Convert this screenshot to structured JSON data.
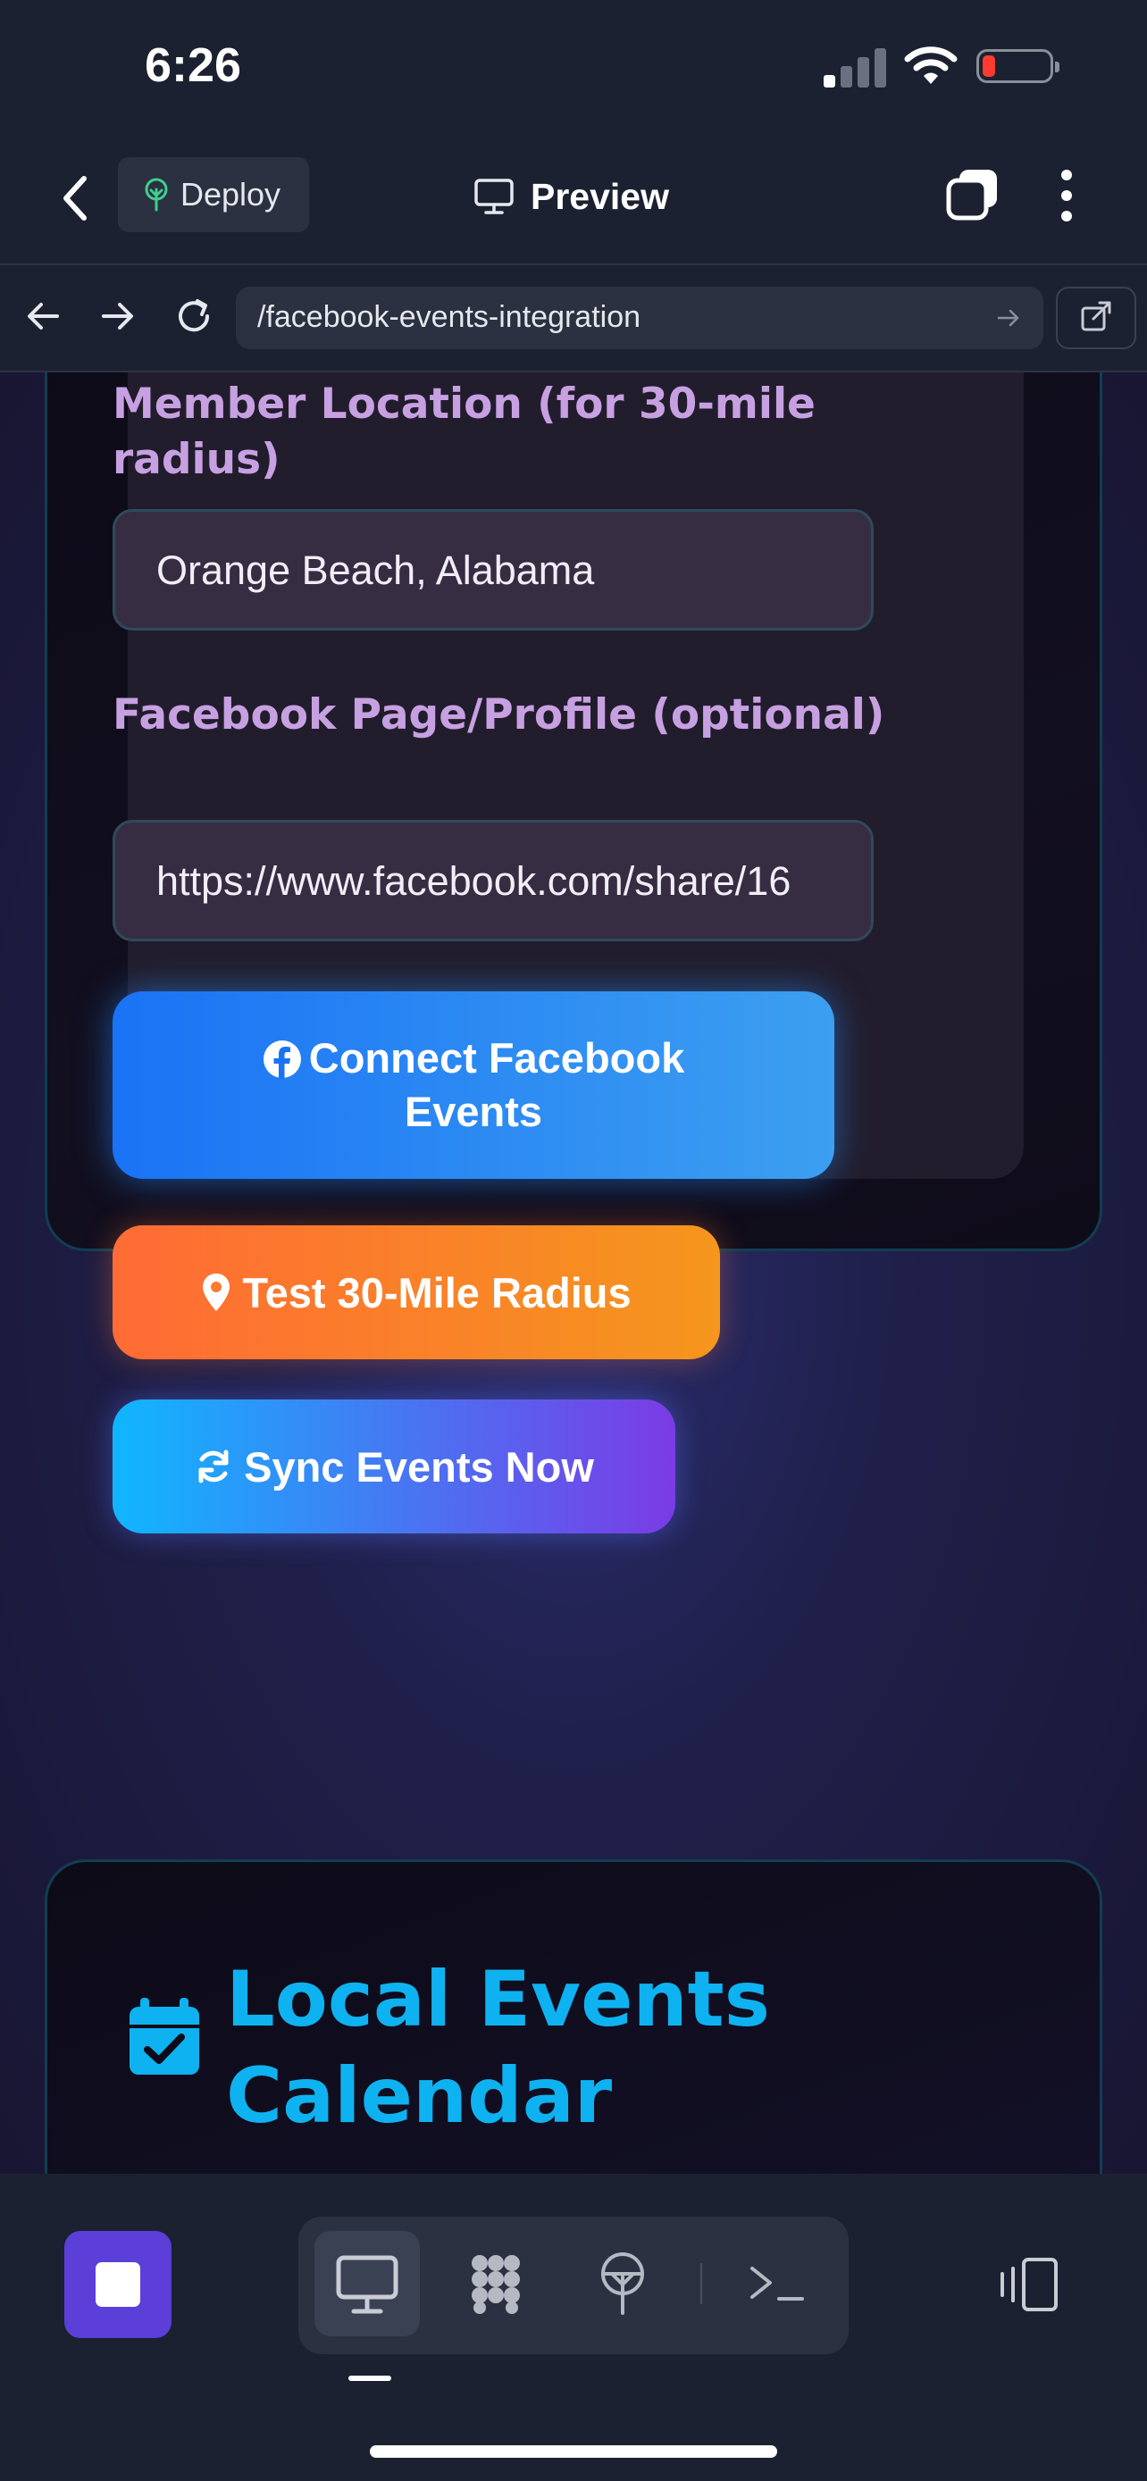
{
  "status_bar": {
    "time": "6:26"
  },
  "top_bar": {
    "deploy_label": "Deploy",
    "preview_label": "Preview"
  },
  "url_bar": {
    "url": "/facebook-events-integration"
  },
  "form": {
    "location_label": "Member Location (for 30-mile radius)",
    "location_value": "Orange Beach, Alabama",
    "facebook_label": "Facebook Page/Profile (optional)",
    "facebook_value": "https://www.facebook.com/share/16"
  },
  "buttons": {
    "connect_facebook": "Connect Facebook Events",
    "test_radius": "Test 30-Mile Radius",
    "sync_events": "Sync Events Now"
  },
  "calendar_section": {
    "title": "Local Events Calendar"
  },
  "colors": {
    "accent_blue": "#1a73f5",
    "accent_orange": "#ff6b35",
    "accent_purple": "#7b3be6",
    "label_lavender": "#c7a0e2",
    "calendar_title": "#0fb2f0",
    "stop_button": "#5b3fd8"
  },
  "icons": {
    "deploy": "deploy-tree-icon",
    "preview": "monitor-icon",
    "connect": "facebook-icon",
    "test": "map-pin-icon",
    "sync": "refresh-icon",
    "calendar": "calendar-check-icon"
  }
}
